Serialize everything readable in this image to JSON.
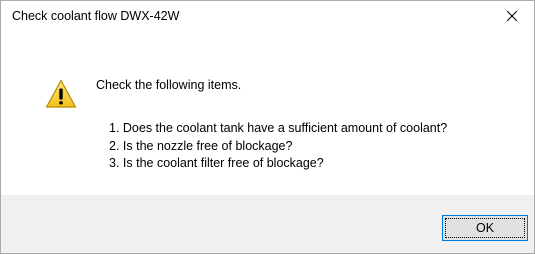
{
  "window": {
    "title": "Check coolant flow DWX-42W",
    "close_icon": "close-icon"
  },
  "message": {
    "icon": "warning-icon",
    "heading": "Check the following items.",
    "items": [
      "1. Does the coolant tank have a sufficient amount of coolant?",
      "2. Is the nozzle free of blockage?",
      "3. Is the coolant filter free of blockage?"
    ]
  },
  "buttons": {
    "ok_label": "OK"
  },
  "colors": {
    "accent_border": "#0078d7",
    "footer_bg": "#f0f0f0",
    "warning_yellow": "#f7d03c"
  }
}
